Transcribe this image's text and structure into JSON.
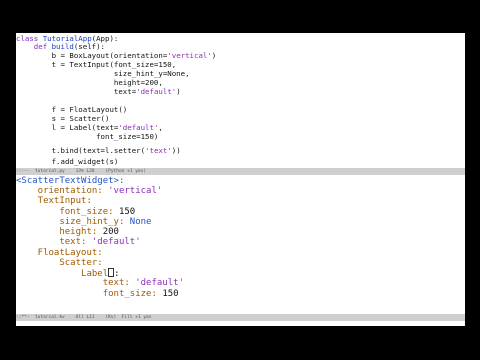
{
  "top_pane": {
    "lines": [
      [
        "class ",
        "TutorialApp",
        "(App):"
      ],
      [
        "    def ",
        "build",
        "(self):"
      ],
      [
        "        b = BoxLayout(orientation=",
        "'vertical'",
        ")"
      ],
      [
        "        t = TextInput(font_size=150,"
      ],
      [
        "                      size_hint_y=None,"
      ],
      [
        "                      height=200,"
      ],
      [
        "                      text=",
        "'default'",
        ")"
      ],
      [
        ""
      ],
      [
        "        f = FloatLayout()"
      ],
      [
        "        s = Scatter()"
      ],
      [
        "        l = Label(text=",
        "'default'",
        ","
      ],
      [
        "                  font_size=150)"
      ],
      [
        ""
      ],
      [
        "        t.bind(text=l.setter(",
        "'text'",
        "))"
      ],
      [
        ""
      ],
      [
        "        f.add_widget(s)"
      ]
    ],
    "modeline": "-:---  tutorial.py    13% L28    (Python +1 yas)"
  },
  "bottom_pane": {
    "lines": [
      [
        "<ScatterTextWidget>:"
      ],
      [
        "    orientation: ",
        "'vertical'"
      ],
      [
        "    TextInput:"
      ],
      [
        "        font_size: ",
        "150"
      ],
      [
        "        size_hint_y: ",
        "None"
      ],
      [
        "        height: ",
        "200"
      ],
      [
        "        text: ",
        "'default'"
      ],
      [
        "    FloatLayout:"
      ],
      [
        "        Scatter:"
      ],
      [
        "            Label",
        ":"
      ],
      [
        "                text: ",
        "'default'"
      ],
      [
        "                font_size: ",
        "150"
      ]
    ],
    "modeline": "-:**-  tutorial.kv    All L11    (Kv)  Fill +1 yas"
  }
}
